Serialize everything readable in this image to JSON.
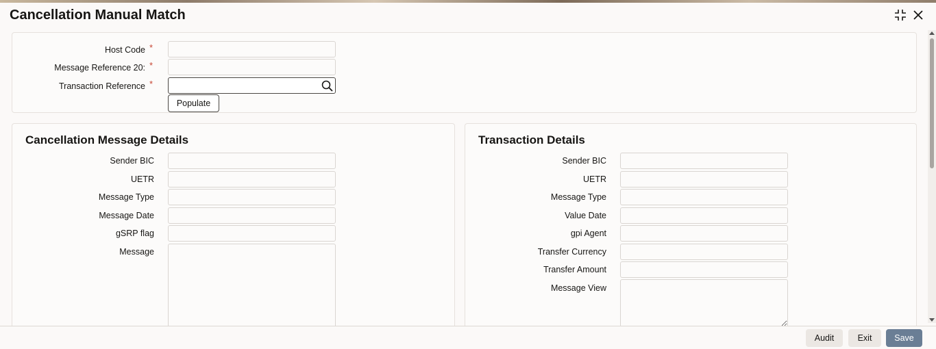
{
  "window": {
    "title": "Cancellation Manual Match",
    "icons": {
      "maximize": "maximize-icon",
      "close": "close-icon"
    }
  },
  "header": {
    "host_code_label": "Host Code",
    "host_code_value": "",
    "message_ref_label": "Message Reference 20:",
    "message_ref_value": "",
    "txn_ref_label": "Transaction Reference",
    "txn_ref_value": "",
    "required_mark": "*",
    "populate_label": "Populate"
  },
  "cancellation": {
    "title": "Cancellation Message Details",
    "sender_bic_label": "Sender BIC",
    "uetr_label": "UETR",
    "message_type_label": "Message Type",
    "message_date_label": "Message Date",
    "gsrp_flag_label": "gSRP flag",
    "message_label": "Message"
  },
  "transaction": {
    "title": "Transaction Details",
    "sender_bic_label": "Sender BIC",
    "uetr_label": "UETR",
    "message_type_label": "Message Type",
    "value_date_label": "Value Date",
    "gpi_agent_label": "gpi Agent",
    "transfer_currency_label": "Transfer Currency",
    "transfer_amount_label": "Transfer Amount",
    "message_view_label": "Message View"
  },
  "footer": {
    "audit_label": "Audit",
    "exit_label": "Exit",
    "save_label": "Save"
  },
  "colors": {
    "accent": "#6a7e95",
    "required": "#c74634"
  }
}
